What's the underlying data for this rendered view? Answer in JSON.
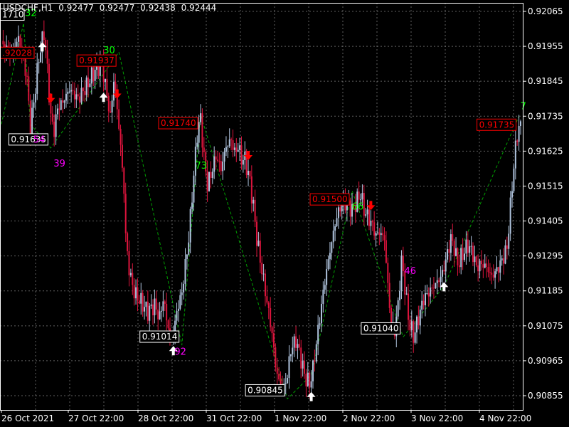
{
  "header": {
    "symbol": "USDCHF,H1",
    "open": "0.92477",
    "high": "0.92477",
    "low": "0.92438",
    "close": "0.92444"
  },
  "colors": {
    "background": "#000000",
    "grid": "#a0a0a0",
    "frame": "#ffffff",
    "bull": "#b0c4de",
    "bear": "#dc143c",
    "zigzag": "#00a000",
    "high_label": "#ff0000",
    "low_label": "#ffffff",
    "high_count": "#00ff00",
    "low_count": "#ff00ff",
    "arrow_up": "#ffffff",
    "arrow_down": "#ff0000"
  },
  "chart_data": {
    "type": "candlestick",
    "title": "USDCHF,H1",
    "xlabel": "",
    "ylabel": "",
    "ylim": [
      0.908,
      0.921
    ],
    "grid": true,
    "y_ticks": [
      "0.92065",
      "0.91955",
      "0.91845",
      "0.91735",
      "0.91625",
      "0.91515",
      "0.91405",
      "0.91295",
      "0.91185",
      "0.91075",
      "0.90965",
      "0.90855"
    ],
    "x_ticks": [
      "26 Oct 2021",
      "27 Oct 22:00",
      "28 Oct 22:00",
      "31 Oct 22:00",
      "1 Nov 22:00",
      "2 Nov 22:00",
      "3 Nov 22:00",
      "4 Nov 22:00"
    ],
    "price_path": [
      [
        0,
        0.9196
      ],
      [
        6,
        0.9193
      ],
      [
        10,
        0.9198
      ],
      [
        13,
        0.9191
      ],
      [
        15,
        0.9185
      ],
      [
        17,
        0.917
      ],
      [
        19,
        0.9178
      ],
      [
        22,
        0.9192
      ],
      [
        25,
        0.92
      ],
      [
        27,
        0.9188
      ],
      [
        29,
        0.9173
      ],
      [
        31,
        0.9169
      ],
      [
        33,
        0.9176
      ],
      [
        36,
        0.9178
      ],
      [
        40,
        0.9182
      ],
      [
        45,
        0.9179
      ],
      [
        50,
        0.9183
      ],
      [
        55,
        0.9188
      ],
      [
        59,
        0.919
      ],
      [
        62,
        0.918
      ],
      [
        64,
        0.9173
      ],
      [
        66,
        0.9185
      ],
      [
        68,
        0.9176
      ],
      [
        70,
        0.9164
      ],
      [
        72,
        0.915
      ],
      [
        73,
        0.9136
      ],
      [
        75,
        0.9125
      ],
      [
        78,
        0.9118
      ],
      [
        82,
        0.9115
      ],
      [
        86,
        0.9112
      ],
      [
        90,
        0.9114
      ],
      [
        93,
        0.911
      ],
      [
        95,
        0.9116
      ],
      [
        97,
        0.911
      ],
      [
        99,
        0.9104
      ],
      [
        101,
        0.9105
      ],
      [
        103,
        0.9112
      ],
      [
        106,
        0.9118
      ],
      [
        110,
        0.9135
      ],
      [
        113,
        0.9155
      ],
      [
        115,
        0.9168
      ],
      [
        117,
        0.9173
      ],
      [
        119,
        0.916
      ],
      [
        121,
        0.9152
      ],
      [
        123,
        0.9155
      ],
      [
        126,
        0.9161
      ],
      [
        129,
        0.9157
      ],
      [
        132,
        0.9164
      ],
      [
        135,
        0.9166
      ],
      [
        137,
        0.9162
      ],
      [
        139,
        0.9164
      ],
      [
        141,
        0.916
      ],
      [
        143,
        0.916
      ],
      [
        146,
        0.9153
      ],
      [
        148,
        0.9145
      ],
      [
        150,
        0.9135
      ],
      [
        153,
        0.9125
      ],
      [
        156,
        0.9115
      ],
      [
        159,
        0.9105
      ],
      [
        161,
        0.9095
      ],
      [
        163,
        0.909
      ],
      [
        166,
        0.9088
      ],
      [
        168,
        0.9092
      ],
      [
        170,
        0.91
      ],
      [
        173,
        0.9103
      ],
      [
        176,
        0.9097
      ],
      [
        178,
        0.9092
      ],
      [
        181,
        0.9089
      ],
      [
        183,
        0.9094
      ],
      [
        186,
        0.9106
      ],
      [
        189,
        0.9118
      ],
      [
        191,
        0.9125
      ],
      [
        194,
        0.9134
      ],
      [
        197,
        0.9142
      ],
      [
        200,
        0.9146
      ],
      [
        203,
        0.9146
      ],
      [
        206,
        0.9144
      ],
      [
        209,
        0.9147
      ],
      [
        211,
        0.9149
      ],
      [
        213,
        0.9144
      ],
      [
        216,
        0.9141
      ],
      [
        218,
        0.9139
      ],
      [
        220,
        0.9136
      ],
      [
        222,
        0.9137
      ],
      [
        225,
        0.9135
      ],
      [
        227,
        0.912
      ],
      [
        229,
        0.9108
      ],
      [
        231,
        0.9106
      ],
      [
        233,
        0.9114
      ],
      [
        235,
        0.9128
      ],
      [
        237,
        0.912
      ],
      [
        239,
        0.911
      ],
      [
        242,
        0.9104
      ],
      [
        244,
        0.9108
      ],
      [
        246,
        0.9112
      ],
      [
        248,
        0.9116
      ],
      [
        251,
        0.9118
      ],
      [
        254,
        0.912
      ],
      [
        257,
        0.9122
      ],
      [
        259,
        0.9124
      ],
      [
        261,
        0.9128
      ],
      [
        264,
        0.9135
      ],
      [
        266,
        0.9132
      ],
      [
        268,
        0.9127
      ],
      [
        271,
        0.913
      ],
      [
        274,
        0.9133
      ],
      [
        277,
        0.913
      ],
      [
        279,
        0.9126
      ],
      [
        282,
        0.9127
      ],
      [
        285,
        0.9126
      ],
      [
        288,
        0.9123
      ],
      [
        291,
        0.9125
      ],
      [
        294,
        0.9128
      ],
      [
        297,
        0.9132
      ],
      [
        299,
        0.9145
      ],
      [
        301,
        0.9158
      ],
      [
        302,
        0.9163
      ],
      [
        303,
        0.9168
      ],
      [
        304,
        0.917
      ]
    ],
    "zigzag": [
      [
        0,
        0.9171
      ],
      [
        13,
        0.92028
      ],
      [
        17,
        0.9171
      ],
      [
        29,
        0.91635
      ],
      [
        69,
        0.91937
      ],
      [
        106,
        0.91014
      ],
      [
        117,
        0.9174
      ],
      [
        168,
        0.90845
      ],
      [
        182,
        0.9092
      ],
      [
        206,
        0.915
      ],
      [
        236,
        0.9104
      ],
      [
        260,
        0.912
      ],
      [
        304,
        0.91735
      ]
    ],
    "high_labels": [
      {
        "i": 1,
        "value": ".92028"
      },
      {
        "i": 69,
        "value": "0.91937"
      },
      {
        "i": 117,
        "value": "0.91740"
      },
      {
        "i": 206,
        "value": "0.91500"
      },
      {
        "i": 304,
        "value": "0.91735"
      }
    ],
    "low_labels": [
      {
        "i": 13,
        "value": "1710"
      },
      {
        "i": 29,
        "value": "0.91635"
      },
      {
        "i": 106,
        "value": "0.91014"
      },
      {
        "i": 168,
        "value": "0.90845"
      },
      {
        "i": 236,
        "value": "0.91040"
      }
    ],
    "high_counts": [
      {
        "i": 13,
        "value": "32"
      },
      {
        "i": 59,
        "value": "30"
      },
      {
        "i": 113,
        "value": "73"
      },
      {
        "i": 205,
        "value": "66"
      },
      {
        "i": 304,
        "value": "7"
      }
    ],
    "low_counts": [
      {
        "i": 17,
        "value": "54"
      },
      {
        "i": 29,
        "value": "39"
      },
      {
        "i": 100,
        "value": "92"
      },
      {
        "i": 235,
        "value": "46"
      }
    ],
    "up_arrows": [
      24,
      60,
      101,
      182,
      260
    ],
    "down_arrows": [
      29,
      68,
      145,
      217
    ]
  }
}
